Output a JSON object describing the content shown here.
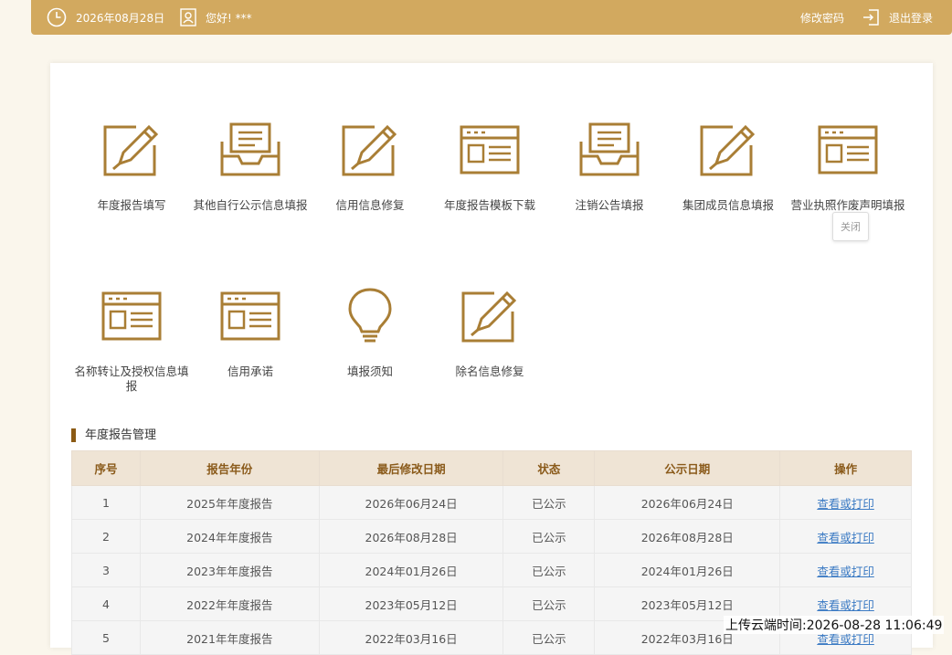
{
  "topbar": {
    "date": "2026年08月28日",
    "greeting": "您好! ***",
    "change_password": "修改密码",
    "logout": "退出登录"
  },
  "tiles_row1": [
    {
      "label": "年度报告填写",
      "icon": "edit-pencil-icon"
    },
    {
      "label": "其他自行公示信息填报",
      "icon": "inbox-tray-icon"
    },
    {
      "label": "信用信息修复",
      "icon": "edit-pencil-icon"
    },
    {
      "label": "年度报告模板下载",
      "icon": "browser-window-icon"
    },
    {
      "label": "注销公告填报",
      "icon": "inbox-tray-icon"
    },
    {
      "label": "集团成员信息填报",
      "icon": "edit-pencil-icon"
    },
    {
      "label": "营业执照作废声明填报",
      "icon": "browser-window-icon"
    }
  ],
  "tiles_row2": [
    {
      "label": "名称转让及授权信息填报",
      "icon": "browser-window-icon"
    },
    {
      "label": "信用承诺",
      "icon": "browser-window-icon"
    },
    {
      "label": "填报须知",
      "icon": "light-bulb-icon"
    },
    {
      "label": "除名信息修复",
      "icon": "edit-pencil-icon"
    }
  ],
  "tooltip": "关闭",
  "section_title": "年度报告管理",
  "table": {
    "headers": [
      "序号",
      "报告年份",
      "最后修改日期",
      "状态",
      "公示日期",
      "操作"
    ],
    "rows": [
      [
        "1",
        "2025年年度报告",
        "2026年06月24日",
        "已公示",
        "2026年06月24日",
        "查看或打印"
      ],
      [
        "2",
        "2024年年度报告",
        "2026年08月28日",
        "已公示",
        "2026年08月28日",
        "查看或打印"
      ],
      [
        "3",
        "2023年年度报告",
        "2024年01月26日",
        "已公示",
        "2024年01月26日",
        "查看或打印"
      ],
      [
        "4",
        "2022年年度报告",
        "2023年05月12日",
        "已公示",
        "2023年05月12日",
        "查看或打印"
      ],
      [
        "5",
        "2021年年度报告",
        "2022年03月16日",
        "已公示",
        "2022年03月16日",
        "查看或打印"
      ]
    ]
  },
  "watermark": "上传云端时间:2026-08-28 11:06:49",
  "colors": {
    "accent": "#d2a95f",
    "icon": "#a97e35",
    "link": "#3c7bc4"
  }
}
